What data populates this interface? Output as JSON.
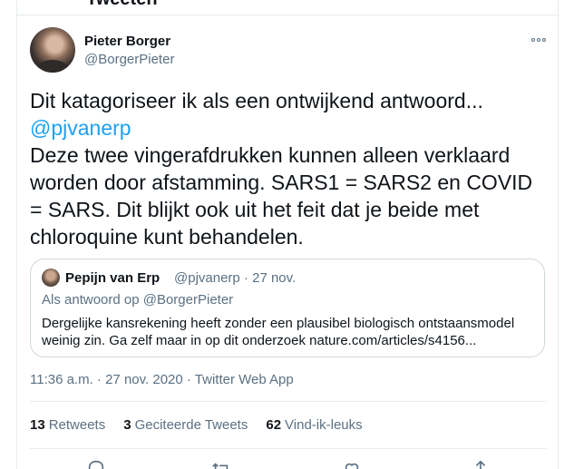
{
  "header": {
    "title": "Tweeten"
  },
  "tweet": {
    "author": {
      "name": "Pieter Borger",
      "handle": "@BorgerPieter"
    },
    "text_line1": "Dit katagoriseer ik als een ontwijkend antwoord...",
    "mention": "@pjvanerp",
    "text_body": "Deze twee vingerafdrukken kunnen alleen verklaard worden door afstamming. SARS1 = SARS2 en COVID = SARS. Dit blijkt ook uit het feit dat je beide met chloroquine kunt behandelen.",
    "timestamp": "11:36 a.m. · 27 nov. 2020 · Twitter Web App"
  },
  "quote": {
    "name": "Pepijn van Erp",
    "meta": "@pjvanerp · 27 nov.",
    "reply_to": "Als antwoord op @BorgerPieter",
    "body": "Dergelijke kansrekening heeft zonder een plausibel biologisch ontstaansmodel weinig zin. Ga zelf maar in op dit onderzoek nature.com/articles/s4156..."
  },
  "stats": {
    "retweets_count": "13",
    "retweets_label": "Retweets",
    "quotes_count": "3",
    "quotes_label": "Geciteerde Tweets",
    "likes_count": "62",
    "likes_label": "Vind-ik-leuks"
  },
  "icons": {
    "more": "more-horizontal-icon",
    "reply": "reply-icon",
    "retweet": "retweet-icon",
    "like": "heart-icon",
    "share": "share-icon"
  },
  "colors": {
    "link": "#1da1f2",
    "secondary": "#5b7083",
    "text": "#0f1419",
    "border": "#e6ecf0"
  }
}
